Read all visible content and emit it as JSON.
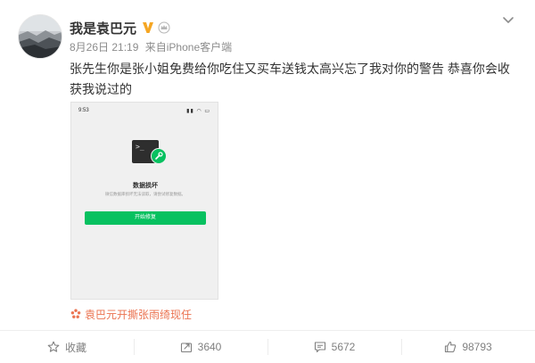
{
  "post": {
    "author": "我是袁巴元",
    "date": "8月26日 21:19",
    "source_prefix": "来自",
    "device": "iPhone客户端",
    "text": "张先生你是张小姐免费给你吃住又买车送钱太高兴忘了我对你的警告 恭喜你会收获我说过的",
    "icons": [
      "avatar",
      "v-badge-icon",
      "crown-icon",
      "chevron-down-icon"
    ],
    "accent_color": "#eb7350"
  },
  "screenshot": {
    "status_time": "9:53",
    "status_icons": "▮▮ ◠ ▭",
    "title": "数据损坏",
    "description": "微信数据库损坏无法读取，请尝试修复数据。",
    "button_label": "开始修复",
    "button_color": "#07c160"
  },
  "super_topic": {
    "label": "袁巴元开撕张雨绮现任",
    "icon": "super-topic-icon"
  },
  "actions": {
    "favorite": {
      "label": "收藏",
      "icon": "star-icon"
    },
    "repost": {
      "count": "3640",
      "icon": "repost-icon"
    },
    "comment": {
      "count": "5672",
      "icon": "comment-icon"
    },
    "like": {
      "count": "98793",
      "icon": "thumb-up-icon"
    }
  }
}
